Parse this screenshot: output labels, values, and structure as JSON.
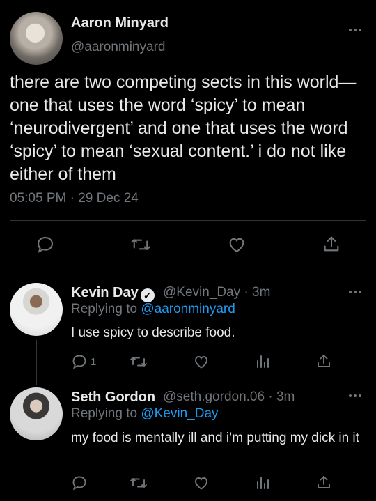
{
  "main_tweet": {
    "author_name": "Aaron Minyard",
    "author_handle": "@aaronminyard",
    "text": "there are two competing sects in this world—one that uses the word ‘spicy’ to mean ‘neurodivergent’ and one that uses the word ‘spicy’ to mean ‘sexual content.’ i do not like either of them",
    "timestamp": "05:05 PM · 29 Dec 24"
  },
  "replies": [
    {
      "author_name": "Kevin Day",
      "author_handle": "@Kevin_Day",
      "time": "· 3m",
      "replying_label": "Replying to",
      "replying_handle": "@aaronminyard",
      "text": "I use spicy to describe food.",
      "reply_count": "1"
    },
    {
      "author_name": "Seth Gordon",
      "author_handle": "@seth.gordon.06",
      "time": "· 3m",
      "replying_label": "Replying to",
      "replying_handle": "@Kevin_Day",
      "text": "my food is mentally ill and i’m putting my dick in it"
    }
  ],
  "icons": {
    "verified": "verified-badge-icon",
    "reply": "reply-icon",
    "retweet": "retweet-icon",
    "like": "heart-icon",
    "analytics": "analytics-icon",
    "share": "share-icon",
    "more": "more-icon"
  },
  "colors": {
    "background": "#000000",
    "text": "#e7e9ea",
    "muted": "#71767b",
    "link": "#1d9bf0"
  }
}
